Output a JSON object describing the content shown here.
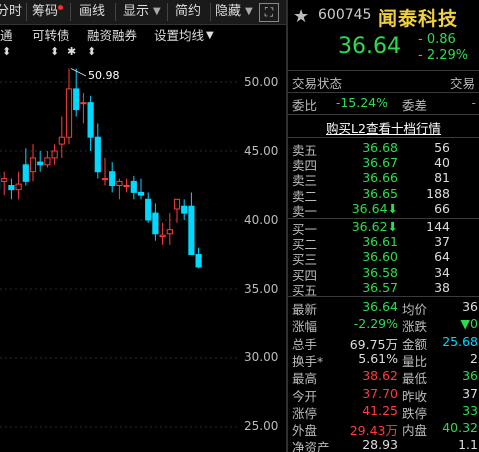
{
  "toolbar": {
    "tabs": [
      {
        "label": "分时",
        "visible_text": "分时"
      },
      {
        "label": "筹码"
      },
      {
        "label": "画线"
      },
      {
        "label": "显示"
      },
      {
        "label": "简约"
      },
      {
        "label": "隐藏"
      }
    ],
    "indicator_items": [
      "通",
      "可转债",
      "融资融券",
      "设置均线"
    ]
  },
  "chart": {
    "y_ticks": [
      "50.00",
      "45.00",
      "40.00",
      "35.00",
      "30.00",
      "25.00"
    ],
    "high_label": "50.98",
    "arrows": [
      "⬍",
      "⬍",
      "✱",
      "⬍"
    ],
    "up_color": "#ff3b3b",
    "down_color": "#00d8ff"
  },
  "chart_data": {
    "type": "candlestick",
    "title": "",
    "yticks": [
      50,
      45,
      40,
      35,
      30,
      25
    ],
    "ylim": [
      23.5,
      55
    ],
    "candles": [
      {
        "o": 43.5,
        "h": 44.8,
        "l": 41.0,
        "c": 42.2
      },
      {
        "o": 42.8,
        "h": 43.5,
        "l": 41.8,
        "c": 43.0
      },
      {
        "o": 42.5,
        "h": 43.0,
        "l": 41.5,
        "c": 42.2
      },
      {
        "o": 42.2,
        "h": 43.5,
        "l": 41.5,
        "c": 42.6
      },
      {
        "o": 44.0,
        "h": 45.2,
        "l": 42.5,
        "c": 42.8
      },
      {
        "o": 43.5,
        "h": 45.5,
        "l": 42.8,
        "c": 44.5
      },
      {
        "o": 44.2,
        "h": 45.0,
        "l": 43.5,
        "c": 44.0
      },
      {
        "o": 44.0,
        "h": 45.0,
        "l": 43.8,
        "c": 44.5
      },
      {
        "o": 44.5,
        "h": 45.5,
        "l": 44.0,
        "c": 45.0
      },
      {
        "o": 45.5,
        "h": 47.5,
        "l": 44.5,
        "c": 46.0
      },
      {
        "o": 46.0,
        "h": 50.98,
        "l": 45.5,
        "c": 49.5
      },
      {
        "o": 49.5,
        "h": 50.98,
        "l": 47.5,
        "c": 48.0
      },
      {
        "o": 48.5,
        "h": 49.2,
        "l": 47.0,
        "c": 48.5
      },
      {
        "o": 48.5,
        "h": 49.0,
        "l": 45.0,
        "c": 46.0
      },
      {
        "o": 46.0,
        "h": 47.0,
        "l": 43.0,
        "c": 43.5
      },
      {
        "o": 43.0,
        "h": 44.5,
        "l": 42.5,
        "c": 43.0
      },
      {
        "o": 43.5,
        "h": 44.2,
        "l": 42.0,
        "c": 42.5
      },
      {
        "o": 42.5,
        "h": 43.0,
        "l": 41.5,
        "c": 42.8
      },
      {
        "o": 42.5,
        "h": 43.0,
        "l": 42.0,
        "c": 42.5
      },
      {
        "o": 42.8,
        "h": 43.2,
        "l": 41.5,
        "c": 42.0
      },
      {
        "o": 42.0,
        "h": 43.0,
        "l": 41.5,
        "c": 41.8
      },
      {
        "o": 41.5,
        "h": 42.0,
        "l": 39.8,
        "c": 40.0
      },
      {
        "o": 40.5,
        "h": 41.2,
        "l": 38.5,
        "c": 39.0
      },
      {
        "o": 38.8,
        "h": 39.8,
        "l": 38.2,
        "c": 38.9
      },
      {
        "o": 39.0,
        "h": 40.5,
        "l": 38.2,
        "c": 39.3
      },
      {
        "o": 40.8,
        "h": 41.5,
        "l": 39.8,
        "c": 41.5
      },
      {
        "o": 41.0,
        "h": 41.5,
        "l": 40.0,
        "c": 40.5
      },
      {
        "o": 41.0,
        "h": 42.0,
        "l": 38.0,
        "c": 37.5
      },
      {
        "o": 37.5,
        "h": 38.0,
        "l": 36.5,
        "c": 36.6
      }
    ]
  },
  "quote": {
    "code": "600745",
    "name": "闻泰科技",
    "price": "36.64",
    "change": "- 0.86",
    "change_pct": "- 2.29%",
    "status_label": "交易状态",
    "status_label2": "交易",
    "ratio_label": "委比",
    "ratio_value": "-15.24%",
    "diff_label": "委差",
    "diff_value": "-",
    "l2_link": "购买L2查看十档行情",
    "sells": [
      {
        "label": "卖五",
        "price": "36.68",
        "vol": "56"
      },
      {
        "label": "卖四",
        "price": "36.67",
        "vol": "40"
      },
      {
        "label": "卖三",
        "price": "36.66",
        "vol": "81"
      },
      {
        "label": "卖二",
        "price": "36.65",
        "vol": "188"
      },
      {
        "label": "卖一",
        "price": "36.64⬇",
        "vol": "66"
      }
    ],
    "buys": [
      {
        "label": "买一",
        "price": "36.62⬇",
        "vol": "144"
      },
      {
        "label": "买二",
        "price": "36.61",
        "vol": "37"
      },
      {
        "label": "买三",
        "price": "36.60",
        "vol": "64"
      },
      {
        "label": "买四",
        "price": "36.58",
        "vol": "34"
      },
      {
        "label": "买五",
        "price": "36.57",
        "vol": "38"
      }
    ],
    "stats": [
      {
        "l1": "最新",
        "v1": "36.64",
        "c1": "g",
        "l2": "均价",
        "v2": "36",
        "c2": "w"
      },
      {
        "l1": "涨幅",
        "v1": "-2.29%",
        "c1": "g",
        "l2": "涨跌",
        "v2": "▼0",
        "c2": "g"
      },
      {
        "l1": "总手",
        "v1": "69.75万",
        "c1": "w",
        "l2": "金额",
        "v2": "25.68",
        "c2": "c"
      },
      {
        "l1": "换手*",
        "v1": "5.61%",
        "c1": "w",
        "l2": "量比",
        "v2": "2",
        "c2": "w"
      },
      {
        "l1": "最高",
        "v1": "38.62",
        "c1": "r",
        "l2": "最低",
        "v2": "36",
        "c2": "g"
      },
      {
        "l1": "今开",
        "v1": "37.70",
        "c1": "r",
        "l2": "昨收",
        "v2": "37",
        "c2": "w"
      },
      {
        "l1": "涨停",
        "v1": "41.25",
        "c1": "r",
        "l2": "跌停",
        "v2": "33",
        "c2": "g"
      },
      {
        "l1": "外盘",
        "v1": "29.43万",
        "c1": "r",
        "l2": "内盘",
        "v2": "40.32",
        "c2": "g"
      },
      {
        "l1": "净资产",
        "v1": "28.93",
        "c1": "w",
        "l2": "",
        "v2": "1.1",
        "c2": "w"
      }
    ]
  }
}
